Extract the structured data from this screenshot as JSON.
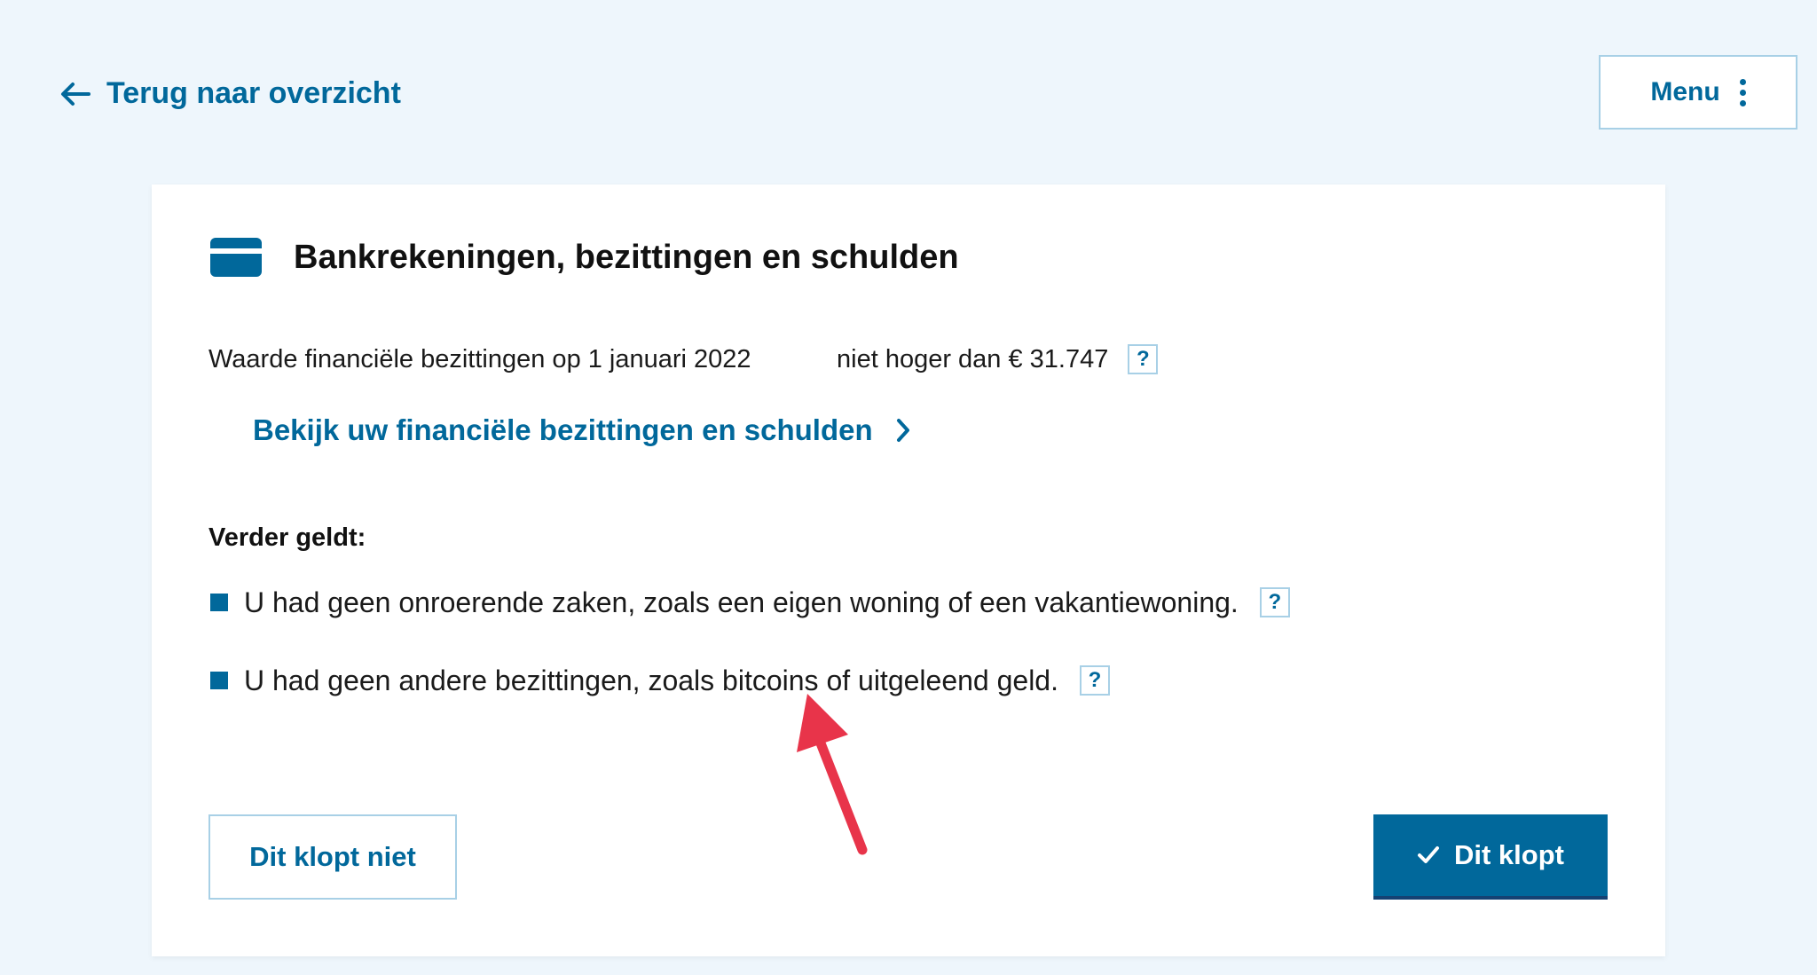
{
  "nav": {
    "back_label": "Terug naar overzicht",
    "menu_label": "Menu"
  },
  "card": {
    "title": "Bankrekeningen, bezittingen en schulden",
    "value_label": "Waarde financiële bezittingen op 1 januari 2022",
    "value_text": "niet hoger dan € 31.747",
    "details_link": "Bekijk uw financiële bezittingen en schulden",
    "subheading": "Verder geldt:",
    "items": [
      {
        "text": "U had geen onroerende zaken, zoals een eigen woning of een vakantiewoning."
      },
      {
        "text": "U had geen andere bezittingen, zoals bitcoins of uitgeleend geld."
      }
    ],
    "help_label": "?",
    "reject_label": "Dit klopt niet",
    "confirm_label": "Dit klopt"
  },
  "icons": {
    "back": "arrow-left-icon",
    "menu": "more-vertical-icon",
    "card": "credit-card-icon",
    "details": "chevron-right-icon",
    "confirm": "check-icon",
    "annotation": "red-arrow"
  },
  "colors": {
    "background": "#eef6fc",
    "brand": "#01689b",
    "border": "#a8d0e6",
    "annotation": "#e8344a"
  }
}
